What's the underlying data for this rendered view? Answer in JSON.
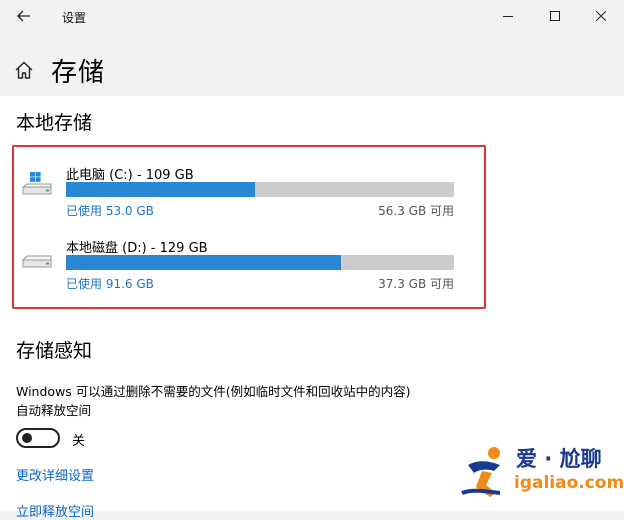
{
  "titlebar": {
    "app_title": "设置",
    "back_icon": "back-arrow-icon",
    "minimize_icon": "minimize-icon",
    "maximize_icon": "maximize-icon",
    "close_icon": "close-icon"
  },
  "header": {
    "home_icon": "home-icon",
    "page_title": "存储"
  },
  "local_storage": {
    "title": "本地存储",
    "drives": [
      {
        "icon": "windows-drive-icon",
        "name": "此电脑 (C:) - 109 GB",
        "used_fraction": 0.486,
        "used_label": "已使用 53.0 GB",
        "free_label": "56.3 GB 可用"
      },
      {
        "icon": "drive-icon",
        "name": "本地磁盘 (D:) - 129 GB",
        "used_fraction": 0.71,
        "used_label": "已使用 91.6 GB",
        "free_label": "37.3 GB 可用"
      }
    ]
  },
  "storage_sense": {
    "title": "存储感知",
    "description_line1": "Windows 可以通过删除不需要的文件(例如临时文件和回收站中的内容)",
    "description_line2": "自动释放空间",
    "toggle_state": "关",
    "toggle_on": false,
    "link_change": "更改详细设置",
    "link_free_now": "立即释放空间"
  },
  "watermark": {
    "brand": "爱 · 尬聊",
    "domain": "igaliao.com",
    "colors": {
      "blue": "#1a3a8f",
      "orange": "#f28a1a"
    }
  },
  "colors": {
    "accent": "#2a88d3",
    "link": "#0a64c8",
    "highlight_border": "#e23232",
    "bar_track": "#cccccc"
  }
}
